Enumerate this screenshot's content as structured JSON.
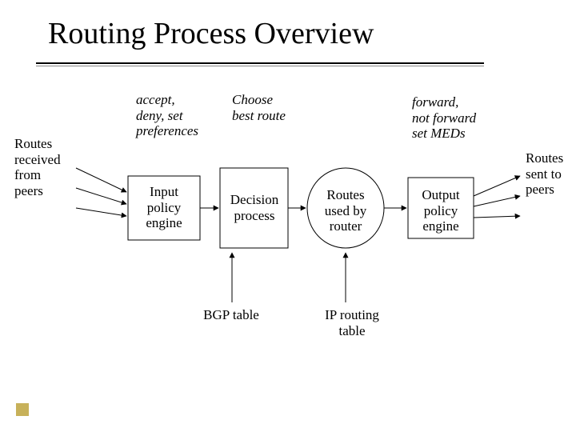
{
  "title": "Routing Process Overview",
  "left_text": "Routes\nreceived\nfrom\npeers",
  "right_text": "Routes\nsent to\npeers",
  "caption_input": "accept,\ndeny, set\npreferences",
  "caption_decision": "Choose\nbest route",
  "caption_output": "forward,\nnot forward\nset MEDs",
  "box_input": "Input\npolicy\nengine",
  "box_decision": "Decision\nprocess",
  "oval_routes": "Routes\nused by\nrouter",
  "box_output": "Output\npolicy\nengine",
  "arrow_bgp": "BGP table",
  "arrow_ip": "IP routing\ntable"
}
